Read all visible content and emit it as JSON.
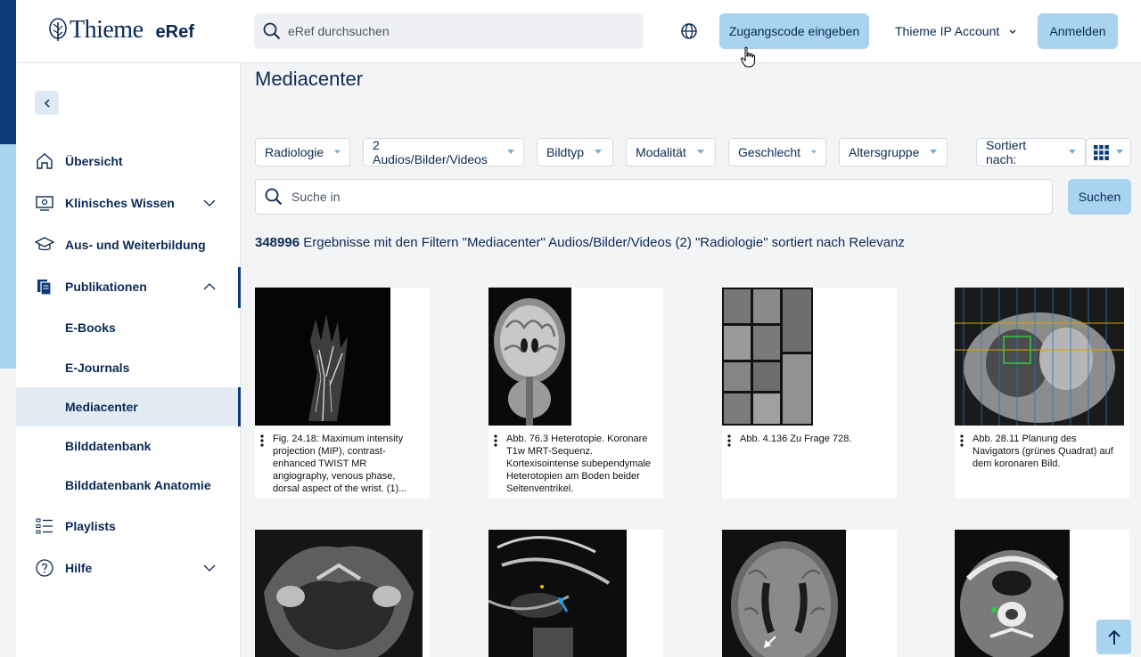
{
  "header": {
    "brand": "Thieme",
    "product": "eRef",
    "search_placeholder": "eRef durchsuchen",
    "access_code_button": "Zugangscode eingeben",
    "ip_account": "Thieme IP Account",
    "login_button": "Anmelden"
  },
  "sidebar": {
    "items": [
      {
        "label": "Übersicht",
        "icon": "home-icon"
      },
      {
        "label": "Klinisches Wissen",
        "icon": "monitor-icon"
      },
      {
        "label": "Aus- und Weiterbildung",
        "icon": "graduation-cap-icon"
      },
      {
        "label": "Publikationen",
        "icon": "publications-icon"
      },
      {
        "label": "E-Books"
      },
      {
        "label": "E-Journals"
      },
      {
        "label": "Mediacenter",
        "active": true
      },
      {
        "label": "Bilddatenbank"
      },
      {
        "label": "Bilddatenbank Anatomie"
      },
      {
        "label": "Playlists",
        "icon": "list-icon"
      },
      {
        "label": "Hilfe",
        "icon": "help-icon"
      }
    ]
  },
  "main": {
    "title": "Mediacenter",
    "filters": [
      "Radiologie",
      "2 Audios/Bilder/Videos",
      "Bildtyp",
      "Modalität",
      "Geschlecht",
      "Altersgruppe"
    ],
    "sort_label": "Sortiert nach:",
    "search_placeholder": "Suche in",
    "search_button": "Suchen",
    "results_count": "348996",
    "results_text": " Ergebnisse mit den Filtern \"Mediacenter\" Audios/Bilder/Videos (2) \"Radiologie\" sortiert nach Relevanz",
    "cards": [
      {
        "caption": "Fig. 24.18: Maximum intensity projection (MIP), contrast-enhanced TWIST MR angiography, venous phase, dorsal aspect of the wrist. (1)..."
      },
      {
        "caption": "Abb. 76.3 Heterotopie. Koronare T1w MRT-Sequenz. Kortexisointense subependymale Heterotopien am Boden beider Seitenventrikel."
      },
      {
        "caption": "Abb. 4.136 Zu Frage 728."
      },
      {
        "caption": "Abb. 28.11 Planung des Navigators (grünes Quadrat) auf dem koronaren Bild."
      }
    ]
  },
  "colors": {
    "navy": "#0b2a55",
    "accent_dark": "#0b3a7a",
    "accent_light": "#a9d3ef",
    "active_bg": "#e2eaf2"
  }
}
